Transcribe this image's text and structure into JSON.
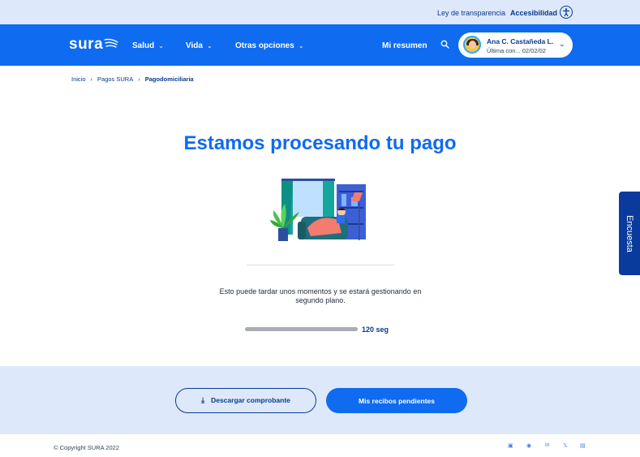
{
  "topbar": {
    "transparency_link": "Ley de transparencia",
    "accessibility_link": "Accesibilidad"
  },
  "nav": {
    "logo": "sura",
    "items": [
      {
        "label": "Salud"
      },
      {
        "label": "Vida"
      },
      {
        "label": "Otras opciones"
      }
    ],
    "summary": "Mi resumen",
    "user": {
      "name": "Ana C. Castañeda L.",
      "last_connection": "Última con... 02/02/02"
    }
  },
  "breadcrumb": [
    "Inicio",
    "Pagos SURA",
    "Pagodomiciliaria"
  ],
  "main": {
    "title": "Estamos procesando tu pago",
    "message": "Esto puede tardar unos momentos y se estará gestionando en segundo plano.",
    "progress_label": "120 seg",
    "progress_fraction": 1.0
  },
  "side_tab": "Encuesta",
  "actions": {
    "download_label": "Descargar comprobante",
    "pending_label": "Mis recibos pendientes"
  },
  "footer": {
    "copyright": "© Copyright SURA 2022"
  },
  "colors": {
    "brand_blue": "#0f6bef",
    "navy": "#0a3a8c",
    "light_band": "#dde8fb"
  }
}
